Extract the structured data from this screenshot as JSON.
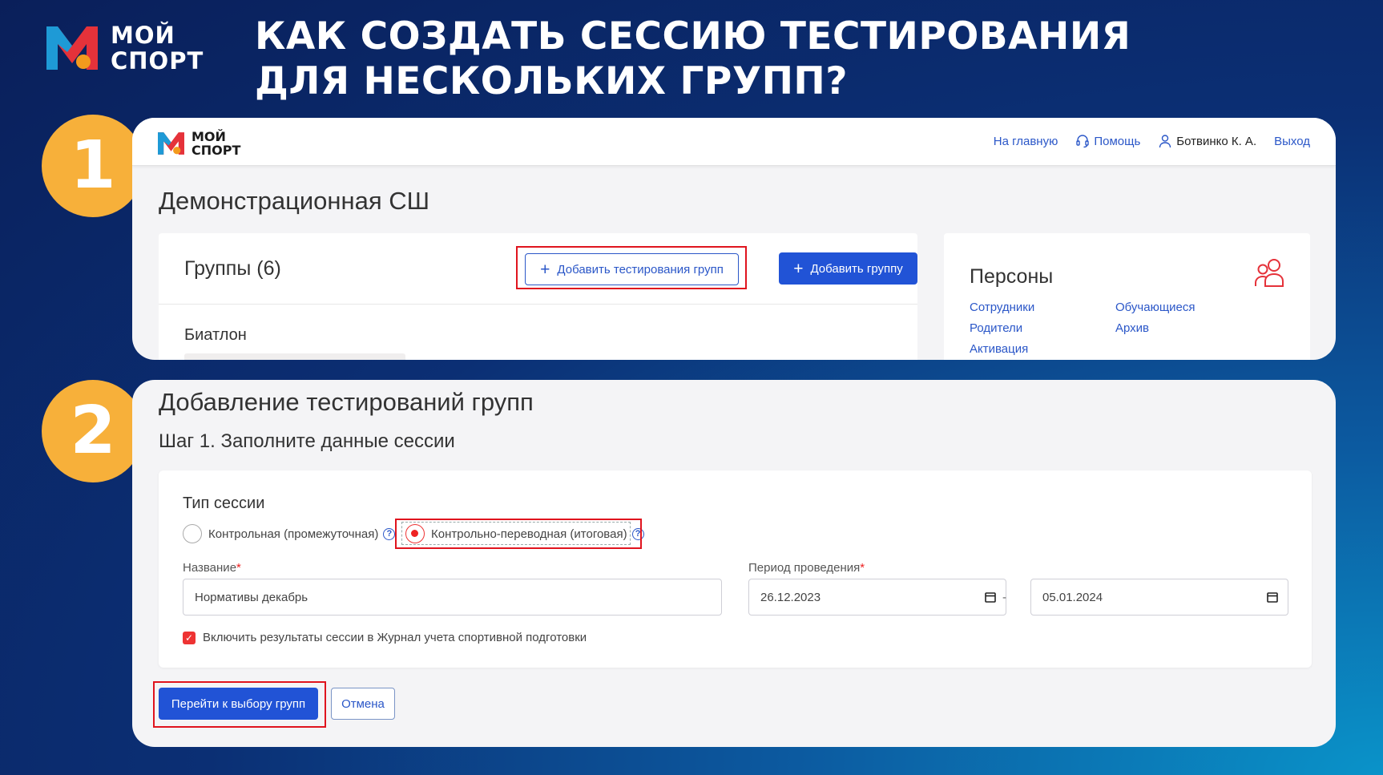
{
  "brand": {
    "name_line1": "МОЙ",
    "name_line2": "СПОРТ",
    "logo_letter": "M"
  },
  "headline": {
    "line1": "КАК СОЗДАТЬ СЕССИЮ ТЕСТИРОВАНИЯ",
    "line2": "ДЛЯ НЕСКОЛЬКИХ ГРУПП?"
  },
  "steps": [
    "1",
    "2"
  ],
  "colors": {
    "step_badge": "#f7b03a",
    "accent_blue": "#2153d6",
    "highlight_red": "#e0141e",
    "logo_red": "#e5323a",
    "logo_blue": "#1e9ad6",
    "logo_orange": "#f39a1d"
  },
  "screen1": {
    "nav": {
      "home": "На главную",
      "help": "Помощь",
      "user": "Ботвинко К. А.",
      "logout": "Выход",
      "help_icon": "headset-icon",
      "user_icon": "user-icon"
    },
    "school_title": "Демонстрационная СШ",
    "groups": {
      "title": "Группы (6)",
      "add_testing_label": "Добавить тестирования групп",
      "add_group_label": "Добавить группу",
      "first_sport": "Биатлон"
    },
    "persons": {
      "title": "Персоны",
      "icon": "people-icon",
      "links": [
        "Сотрудники",
        "Обучающиеся",
        "Родители",
        "Архив",
        "Активация"
      ]
    }
  },
  "screen2": {
    "title": "Добавление тестирований групп",
    "step_label": "Шаг 1. Заполните данные сессии",
    "session_type": {
      "label": "Тип сессии",
      "options": [
        "Контрольная (промежуточная)",
        "Контрольно-переводная (итоговая)"
      ],
      "selected": "Контрольно-переводная (итоговая)"
    },
    "name_field": {
      "label": "Название",
      "value": "Нормативы декабрь"
    },
    "period": {
      "label": "Период проведения",
      "from": "26.12.2023",
      "separator": "-",
      "to": "05.01.2024"
    },
    "required_mark": "*",
    "help_mark": "?",
    "include_journal": {
      "label": "Включить результаты сессии в Журнал учета спортивной подготовки",
      "checked": true,
      "check_glyph": "✓"
    },
    "next_label": "Перейти к выбору групп",
    "cancel_label": "Отмена"
  }
}
